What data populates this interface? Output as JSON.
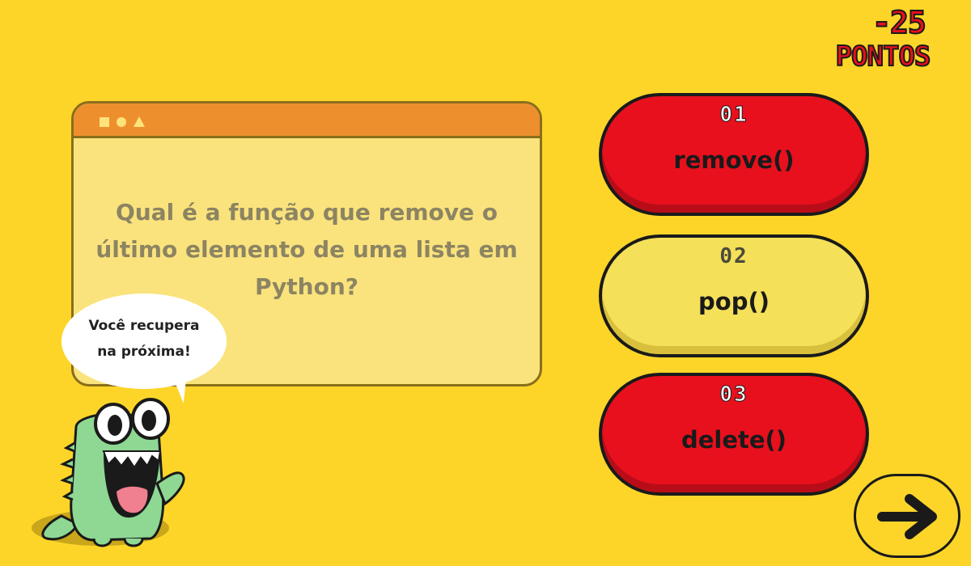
{
  "score": {
    "value": "-25",
    "label": "PONTOS"
  },
  "question": {
    "window_icons": [
      "square-icon",
      "circle-icon",
      "triangle-icon"
    ],
    "line1": "Qual é a função que remove o",
    "line2": "último elemento de uma lista em",
    "line3": "Python?"
  },
  "mascot": {
    "speech_line1": "Você recupera",
    "speech_line2": "na próxima!"
  },
  "answers": [
    {
      "number": "01",
      "label": "remove()",
      "state": "wrong"
    },
    {
      "number": "02",
      "label": "pop()",
      "state": "correct"
    },
    {
      "number": "03",
      "label": "delete()",
      "state": "wrong"
    }
  ],
  "next_button": {
    "icon": "arrow-right-icon"
  },
  "colors": {
    "background": "#FDD529",
    "wrong": "#E8101D",
    "correct": "#F5E05A",
    "window_bar": "#EE8F2E",
    "window_body": "#FAE37D"
  }
}
